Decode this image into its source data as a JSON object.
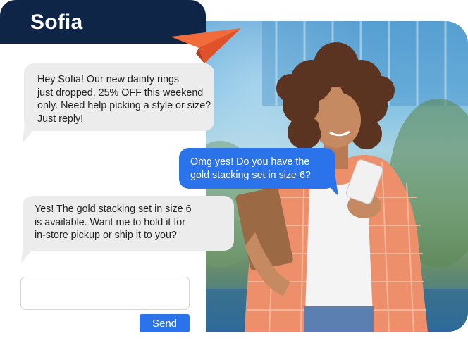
{
  "contact": {
    "name": "Sofia"
  },
  "icons": {
    "send_plane": "paper-plane-icon"
  },
  "colors": {
    "header": "#0f2547",
    "outgoing_bubble": "#2b73ea",
    "incoming_bubble": "#ececec",
    "plane": "#f26b3a",
    "send_button": "#2b73ea"
  },
  "messages": [
    {
      "direction": "incoming",
      "text": "Hey Sofia! Our new dainty rings\njust dropped, 25% OFF this weekend\nonly. Need help picking a style or size?\nJust reply!"
    },
    {
      "direction": "outgoing",
      "text": "Omg yes! Do you have the\ngold stacking set in size 6?"
    },
    {
      "direction": "incoming",
      "text": "Yes! The gold stacking set in size 6\nis available. Want me to hold it for\nin-store pickup or ship it to you?"
    }
  ],
  "composer": {
    "value": "",
    "placeholder": "",
    "send_label": "Send"
  }
}
